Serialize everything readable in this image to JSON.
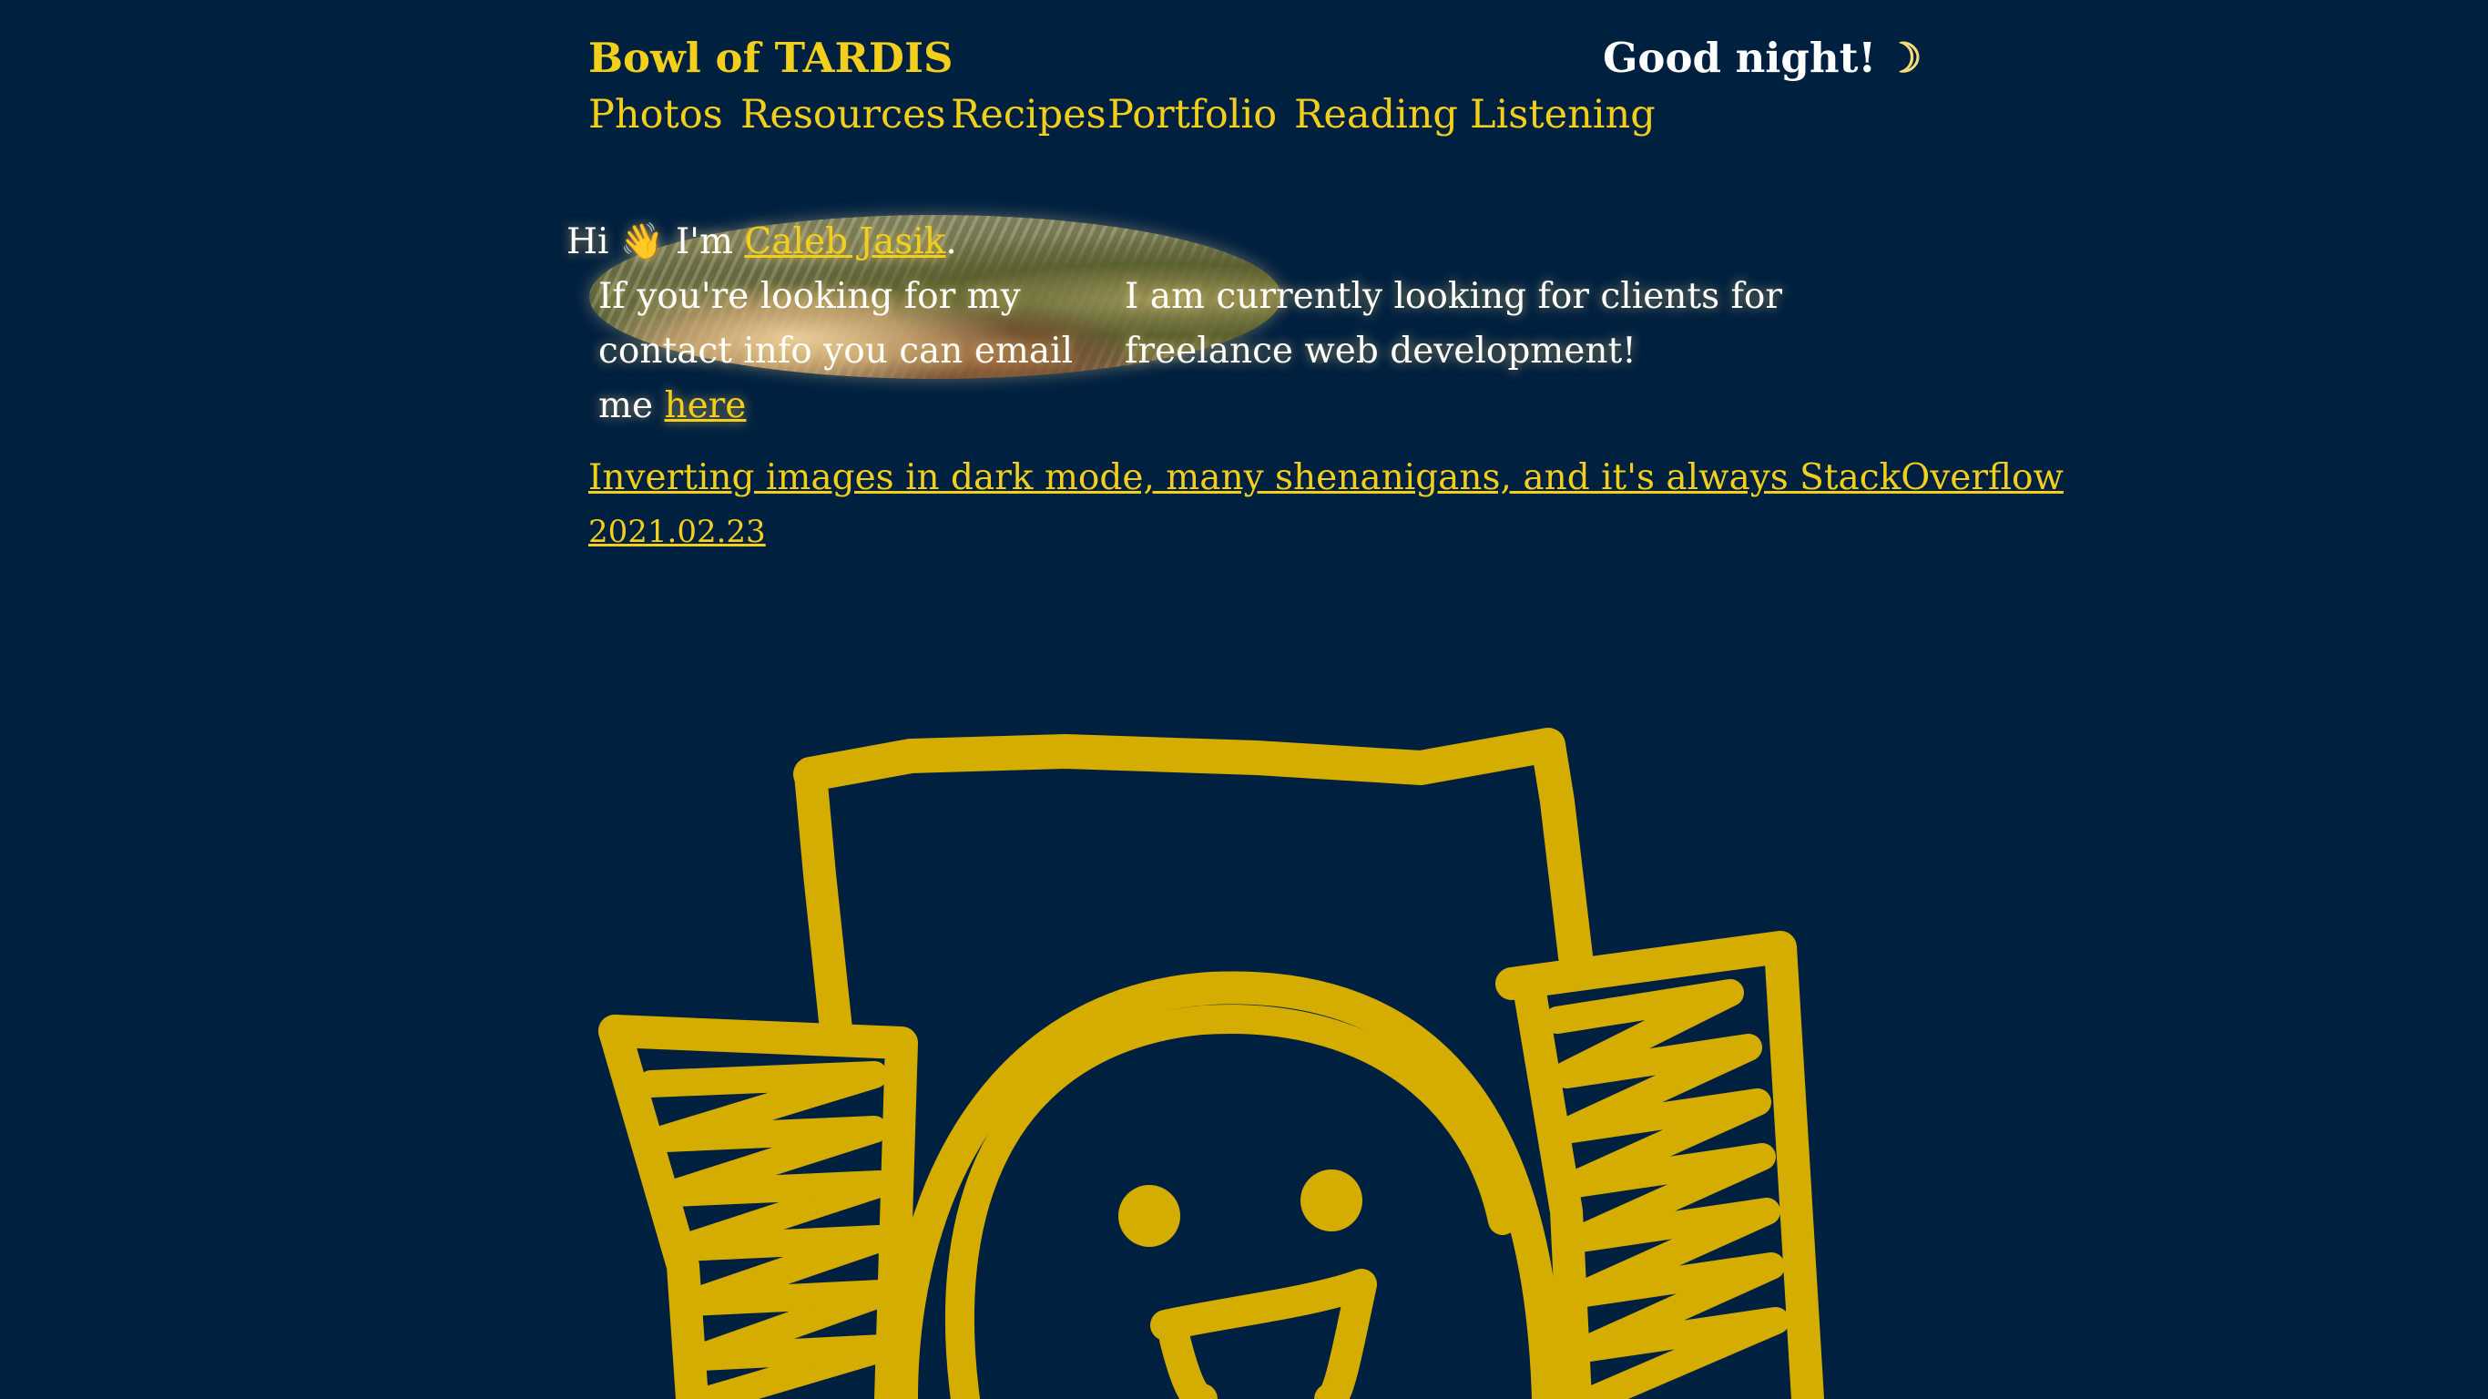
{
  "header": {
    "site_title": "Bowl of TARDIS",
    "greeting": "Good night!",
    "greeting_icon": "moon-icon"
  },
  "nav": {
    "items": [
      {
        "label": "Photos"
      },
      {
        "label": "Resources"
      },
      {
        "label": "Recipes"
      },
      {
        "label": "Portfolio"
      },
      {
        "label": "Reading"
      },
      {
        "label": "Listening"
      }
    ]
  },
  "intro": {
    "hi": "Hi",
    "wave_icon": "waving-hand-icon",
    "im": "I'm",
    "name": "Caleb Jasik",
    "period": ".",
    "contact_text": "If you're looking for my contact info you can email me",
    "contact_link": "here",
    "freelance_text": "I am currently looking for clients for freelance web development!"
  },
  "posts": [
    {
      "title": "Inverting images in dark mode, many shenanigans, and it's always StackOverflow",
      "date": "2021.02.23"
    }
  ],
  "illustration": {
    "name": "smiling-robot-doodle",
    "color": "#d4ad00"
  },
  "colors": {
    "background": "#002040",
    "accent": "#f2cf1a",
    "text": "#ffffff"
  }
}
